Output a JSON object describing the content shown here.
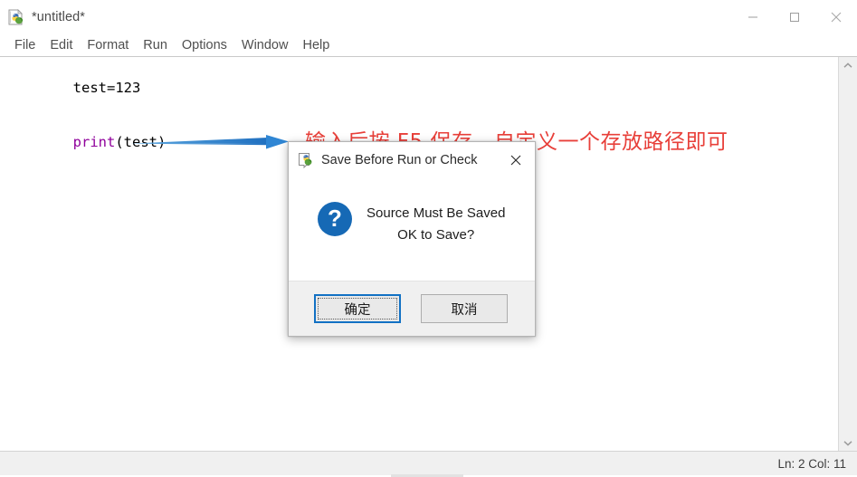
{
  "window": {
    "title": "*untitled*",
    "icon": "idle-python-file-icon",
    "controls": {
      "minimize": "minimize-icon",
      "maximize": "maximize-icon",
      "close": "close-icon"
    }
  },
  "menubar": {
    "items": [
      {
        "label": "File"
      },
      {
        "label": "Edit"
      },
      {
        "label": "Format"
      },
      {
        "label": "Run"
      },
      {
        "label": "Options"
      },
      {
        "label": "Window"
      },
      {
        "label": "Help"
      }
    ]
  },
  "editor": {
    "line1_plain": "test=123",
    "line2_builtin": "print",
    "line2_rest": "(test)",
    "annotation_text": "输入后按 F5 保存，自定义一个存放路径即可",
    "annotation_color": "#e8403a",
    "arrow_color": "#2f86d4",
    "builtin_color": "#8f009b"
  },
  "scrollbar": {
    "up_arrow": "chevron-up-icon",
    "down_arrow": "chevron-down-icon"
  },
  "statusbar": {
    "position": "Ln: 2  Col: 11"
  },
  "dialog": {
    "title": "Save Before Run or Check",
    "icon": "python-idle-icon",
    "close": "close-icon",
    "message_icon": "question-mark-icon",
    "message_icon_color": "#1669b5",
    "message_line1": "Source Must Be Saved",
    "message_line2": "OK to Save?",
    "buttons": {
      "ok": "确定",
      "cancel": "取消"
    }
  }
}
